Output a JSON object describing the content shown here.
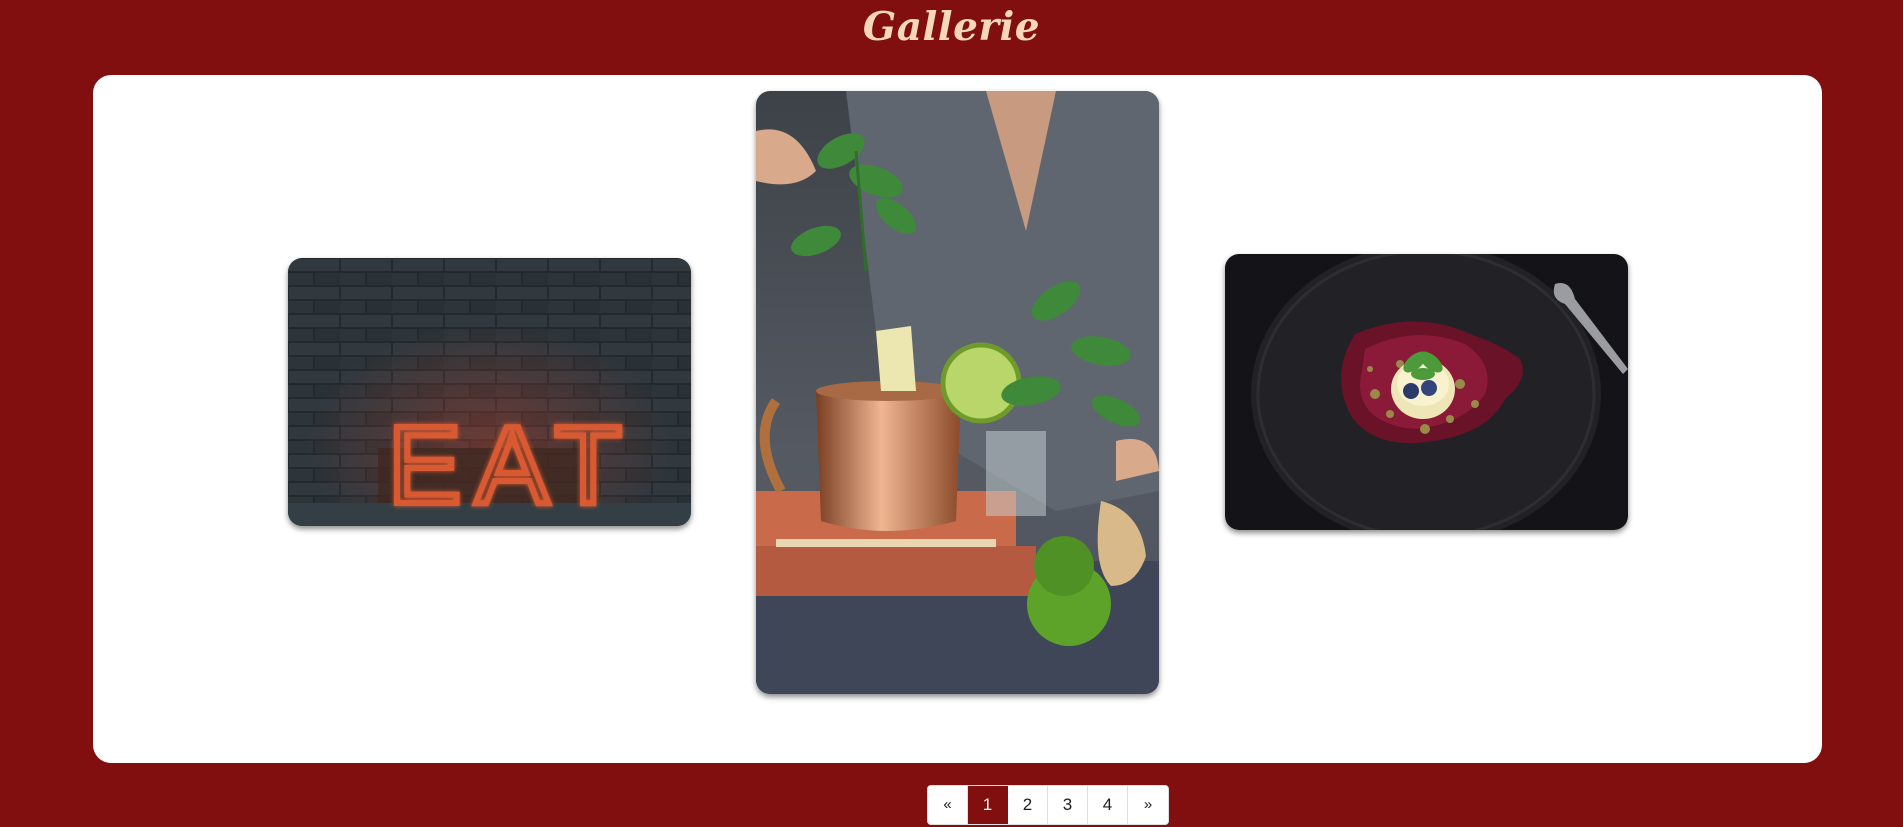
{
  "header": {
    "title": "Gallerie"
  },
  "gallery": {
    "images": [
      {
        "name": "eat-neon-sign-image",
        "sign_text": "EAT"
      },
      {
        "name": "copper-mug-cocktail-image"
      },
      {
        "name": "dessert-plate-image"
      }
    ]
  },
  "pagination": {
    "prev": "«",
    "pages": [
      "1",
      "2",
      "3",
      "4"
    ],
    "next": "»",
    "active_page": "1"
  },
  "colors": {
    "background": "#810f0f",
    "panel": "#ffffff",
    "title": "#f6d7bd",
    "active_page": "#810f0f"
  }
}
